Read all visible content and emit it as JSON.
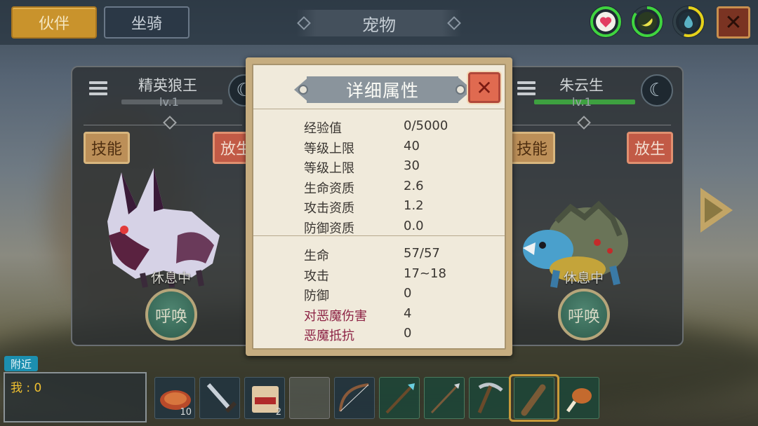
{
  "top_bar": {
    "tab_partner": "伙伴",
    "tab_mount": "坐骑",
    "title": "宠物",
    "status_rings": [
      {
        "icon": "heart-icon",
        "color": "#e23e62",
        "ring": "#3fd43f",
        "level": 1.0
      },
      {
        "icon": "food-icon",
        "color": "#e8e04a",
        "ring": "#3fd43f",
        "level": 0.85
      },
      {
        "icon": "water-drop-icon",
        "color": "#5ab2c4",
        "ring": "#e6d21a",
        "level": 0.55
      }
    ],
    "close_label": "✕"
  },
  "pet_left": {
    "name": "精英狼王",
    "level": "lv.1",
    "skill_label": "技能",
    "release_label": "放生",
    "status": "休息中",
    "summon_label": "呼唤"
  },
  "pet_right": {
    "name": "朱云生",
    "level": "lv.1",
    "skill_label": "技能",
    "release_label": "放生",
    "status": "休息中",
    "summon_label": "呼唤"
  },
  "modal": {
    "title": "详细属性",
    "close_label": "✕",
    "growth_attrs": [
      {
        "key": "经验值",
        "value": "0/5000"
      },
      {
        "key": "等级上限",
        "value": "40"
      },
      {
        "key": "等级上限",
        "value": "30"
      },
      {
        "key": "生命资质",
        "value": "2.6"
      },
      {
        "key": "攻击资质",
        "value": "1.2"
      },
      {
        "key": "防御资质",
        "value": "0.0"
      }
    ],
    "combat_attrs": [
      {
        "key": "生命",
        "value": "57/57"
      },
      {
        "key": "攻击",
        "value": "17~18"
      },
      {
        "key": "防御",
        "value": "0"
      },
      {
        "key": "对恶魔伤害",
        "value": "4",
        "demon": true
      },
      {
        "key": "恶魔抵抗",
        "value": "0",
        "demon": true
      }
    ]
  },
  "chat": {
    "nearby_label": "附近",
    "line": "我 : 0"
  },
  "hotbar": {
    "slots": [
      {
        "item": "meat-icon",
        "count": "10"
      },
      {
        "item": "sword-icon",
        "count": ""
      },
      {
        "item": "food-bag-icon",
        "count": "2"
      },
      {
        "item": "empty",
        "count": ""
      },
      {
        "item": "bow-icon",
        "count": ""
      },
      {
        "item": "spear-icon",
        "count": ""
      },
      {
        "item": "arrow-icon",
        "count": ""
      },
      {
        "item": "pickaxe-icon",
        "count": ""
      },
      {
        "item": "club-icon",
        "count": ""
      },
      {
        "item": "drumstick-icon",
        "count": ""
      }
    ],
    "selected_index": 8
  }
}
